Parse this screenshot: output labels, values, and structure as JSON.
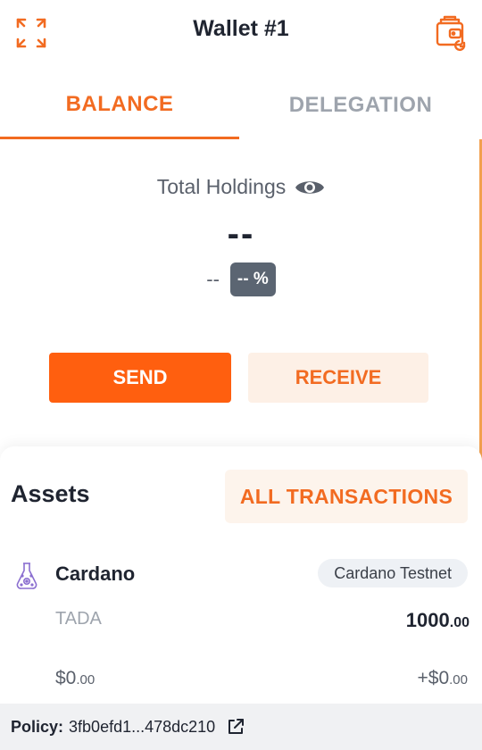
{
  "header": {
    "title": "Wallet #1",
    "expand_icon": "expand-icon",
    "wallet_icon": "wallet-connect-icon"
  },
  "tabs": [
    {
      "label": "BALANCE",
      "active": true
    },
    {
      "label": "DELEGATION",
      "active": false
    }
  ],
  "balance": {
    "holdings_label": "Total Holdings",
    "total_value": "--",
    "change_value": "--",
    "change_percent": "-- %"
  },
  "actions": {
    "send_label": "SEND",
    "receive_label": "RECEIVE"
  },
  "assets": {
    "title": "Assets",
    "all_transactions_label": "ALL TRANSACTIONS",
    "items": [
      {
        "name": "Cardano",
        "network": "Cardano Testnet",
        "ticker": "TADA",
        "amount_int": "1000",
        "amount_dec": ".00",
        "fiat_int": "$0",
        "fiat_dec": ".00",
        "fiat_change_int": "+$0",
        "fiat_change_dec": ".00"
      }
    ]
  },
  "policy": {
    "label": "Policy:",
    "value": "3fb0efd1...478dc210"
  },
  "colors": {
    "accent": "#f26b21",
    "send_bg": "#ff5f0f",
    "receive_bg": "#fdf0e6",
    "badge_bg": "#5b6572",
    "muted_text": "#9ea4ad"
  }
}
